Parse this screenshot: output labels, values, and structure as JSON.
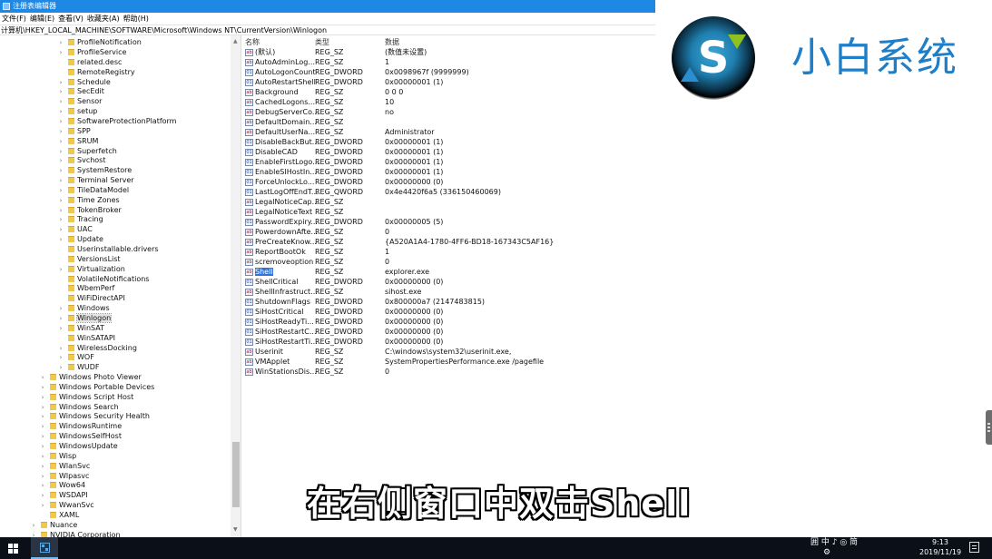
{
  "window": {
    "title": "注册表编辑器",
    "menu": [
      "文件(F)",
      "编辑(E)",
      "查看(V)",
      "收藏夹(A)",
      "帮助(H)"
    ],
    "address": "计算机\\HKEY_LOCAL_MACHINE\\SOFTWARE\\Microsoft\\Windows NT\\CurrentVersion\\Winlogon"
  },
  "tree": {
    "items": [
      {
        "label": "ProfileNotification",
        "expander": "›"
      },
      {
        "label": "ProfileService",
        "expander": "›"
      },
      {
        "label": "related.desc",
        "expander": ""
      },
      {
        "label": "RemoteRegistry",
        "expander": ""
      },
      {
        "label": "Schedule",
        "expander": "›"
      },
      {
        "label": "SecEdit",
        "expander": "›"
      },
      {
        "label": "Sensor",
        "expander": "›"
      },
      {
        "label": "setup",
        "expander": "›"
      },
      {
        "label": "SoftwareProtectionPlatform",
        "expander": "›"
      },
      {
        "label": "SPP",
        "expander": "›"
      },
      {
        "label": "SRUM",
        "expander": "›"
      },
      {
        "label": "Superfetch",
        "expander": "›"
      },
      {
        "label": "Svchost",
        "expander": "›"
      },
      {
        "label": "SystemRestore",
        "expander": "›"
      },
      {
        "label": "Terminal Server",
        "expander": "›"
      },
      {
        "label": "TileDataModel",
        "expander": "›"
      },
      {
        "label": "Time Zones",
        "expander": "›"
      },
      {
        "label": "TokenBroker",
        "expander": "›"
      },
      {
        "label": "Tracing",
        "expander": "›"
      },
      {
        "label": "UAC",
        "expander": "›"
      },
      {
        "label": "Update",
        "expander": "›"
      },
      {
        "label": "Userinstallable.drivers",
        "expander": ""
      },
      {
        "label": "VersionsList",
        "expander": ""
      },
      {
        "label": "Virtualization",
        "expander": "›"
      },
      {
        "label": "VolatileNotifications",
        "expander": ""
      },
      {
        "label": "WbemPerf",
        "expander": ""
      },
      {
        "label": "WiFiDirectAPI",
        "expander": ""
      },
      {
        "label": "Windows",
        "expander": "›"
      },
      {
        "label": "Winlogon",
        "expander": "›",
        "selected": true
      },
      {
        "label": "WinSAT",
        "expander": "›"
      },
      {
        "label": "WinSATAPI",
        "expander": ""
      },
      {
        "label": "WirelessDocking",
        "expander": "›"
      },
      {
        "label": "WOF",
        "expander": "›"
      },
      {
        "label": "WUDF",
        "expander": "›"
      }
    ],
    "items_l2": [
      {
        "label": "Windows Photo Viewer",
        "expander": "›"
      },
      {
        "label": "Windows Portable Devices",
        "expander": "›"
      },
      {
        "label": "Windows Script Host",
        "expander": "›"
      },
      {
        "label": "Windows Search",
        "expander": "›"
      },
      {
        "label": "Windows Security Health",
        "expander": "›"
      },
      {
        "label": "WindowsRuntime",
        "expander": "›"
      },
      {
        "label": "WindowsSelfHost",
        "expander": "›"
      },
      {
        "label": "WindowsUpdate",
        "expander": "›"
      },
      {
        "label": "Wisp",
        "expander": "›"
      },
      {
        "label": "WlanSvc",
        "expander": "›"
      },
      {
        "label": "Wlpasvc",
        "expander": "›"
      },
      {
        "label": "Wow64",
        "expander": "›"
      },
      {
        "label": "WSDAPI",
        "expander": "›"
      },
      {
        "label": "WwanSvc",
        "expander": "›"
      },
      {
        "label": "XAML",
        "expander": ""
      }
    ],
    "items_l1": [
      {
        "label": "Nuance",
        "expander": "›"
      },
      {
        "label": "NVIDIA Corporation",
        "expander": "›"
      }
    ]
  },
  "values": {
    "headers": {
      "name": "名称",
      "type": "类型",
      "data": "数据"
    },
    "rows": [
      {
        "name": "(默认)",
        "type": "REG_SZ",
        "data": "(数值未设置)"
      },
      {
        "name": "AutoAdminLog...",
        "type": "REG_SZ",
        "data": "1"
      },
      {
        "name": "AutoLogonCount",
        "type": "REG_DWORD",
        "data": "0x0098967f (9999999)"
      },
      {
        "name": "AutoRestartShell",
        "type": "REG_DWORD",
        "data": "0x00000001 (1)"
      },
      {
        "name": "Background",
        "type": "REG_SZ",
        "data": "0 0 0"
      },
      {
        "name": "CachedLogons...",
        "type": "REG_SZ",
        "data": "10"
      },
      {
        "name": "DebugServerCo...",
        "type": "REG_SZ",
        "data": "no"
      },
      {
        "name": "DefaultDomain...",
        "type": "REG_SZ",
        "data": ""
      },
      {
        "name": "DefaultUserNa...",
        "type": "REG_SZ",
        "data": "Administrator"
      },
      {
        "name": "DisableBackBut...",
        "type": "REG_DWORD",
        "data": "0x00000001 (1)"
      },
      {
        "name": "DisableCAD",
        "type": "REG_DWORD",
        "data": "0x00000001 (1)"
      },
      {
        "name": "EnableFirstLogo...",
        "type": "REG_DWORD",
        "data": "0x00000001 (1)"
      },
      {
        "name": "EnableSIHostIn...",
        "type": "REG_DWORD",
        "data": "0x00000001 (1)"
      },
      {
        "name": "ForceUnlockLo...",
        "type": "REG_DWORD",
        "data": "0x00000000 (0)"
      },
      {
        "name": "LastLogOffEndT...",
        "type": "REG_QWORD",
        "data": "0x4e4420f6a5 (336150460069)"
      },
      {
        "name": "LegalNoticeCap...",
        "type": "REG_SZ",
        "data": ""
      },
      {
        "name": "LegalNoticeText",
        "type": "REG_SZ",
        "data": ""
      },
      {
        "name": "PasswordExpiry...",
        "type": "REG_DWORD",
        "data": "0x00000005 (5)"
      },
      {
        "name": "PowerdownAfte...",
        "type": "REG_SZ",
        "data": "0"
      },
      {
        "name": "PreCreateKnow...",
        "type": "REG_SZ",
        "data": "{A520A1A4-1780-4FF6-BD18-167343C5AF16}"
      },
      {
        "name": "ReportBootOk",
        "type": "REG_SZ",
        "data": "1"
      },
      {
        "name": "scremoveoption",
        "type": "REG_SZ",
        "data": "0"
      },
      {
        "name": "Shell",
        "type": "REG_SZ",
        "data": "explorer.exe",
        "selected": true
      },
      {
        "name": "ShellCritical",
        "type": "REG_DWORD",
        "data": "0x00000000 (0)"
      },
      {
        "name": "ShellInfrastruct...",
        "type": "REG_SZ",
        "data": "sihost.exe"
      },
      {
        "name": "ShutdownFlags",
        "type": "REG_DWORD",
        "data": "0x800000a7 (2147483815)"
      },
      {
        "name": "SiHostCritical",
        "type": "REG_DWORD",
        "data": "0x00000000 (0)"
      },
      {
        "name": "SiHostReadyTi...",
        "type": "REG_DWORD",
        "data": "0x00000000 (0)"
      },
      {
        "name": "SiHostRestartC...",
        "type": "REG_DWORD",
        "data": "0x00000000 (0)"
      },
      {
        "name": "SiHostRestartTi...",
        "type": "REG_DWORD",
        "data": "0x00000000 (0)"
      },
      {
        "name": "Userinit",
        "type": "REG_SZ",
        "data": "C:\\windows\\system32\\userinit.exe,"
      },
      {
        "name": "VMApplet",
        "type": "REG_SZ",
        "data": "SystemPropertiesPerformance.exe /pagefile"
      },
      {
        "name": "WinStationsDis...",
        "type": "REG_SZ",
        "data": "0"
      }
    ]
  },
  "overlay": {
    "brand": "小白系统",
    "subtitle": "在右侧窗口中双击Shell"
  },
  "taskbar": {
    "ime_top": "囲 中 ♪ ◎ 简",
    "ime_bottom": "⚙",
    "time": "9:13",
    "date": "2019/11/19"
  },
  "colors": {
    "accent": "#1e88e5",
    "brand": "#1e7ec8",
    "taskbar": "#0a0f18",
    "selection": "#3375d6"
  }
}
